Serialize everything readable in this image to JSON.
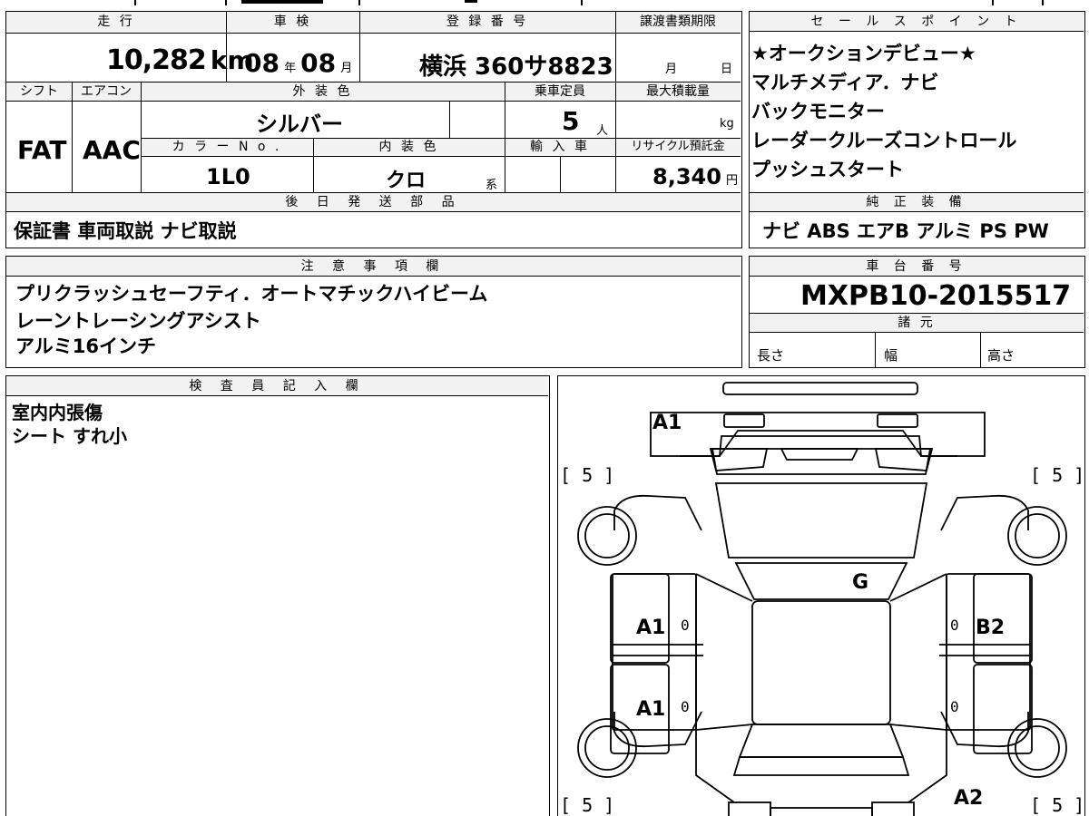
{
  "top_table": {
    "labels": {
      "mileage": "走 行",
      "inspection": "車 検",
      "registration": "登 録 番 号",
      "transfer_deadline": "譲渡書類期限",
      "shift": "シフト",
      "aircon": "エアコン",
      "exterior_color": "外 装 色",
      "capacity": "乗車定員",
      "max_load": "最大積載量",
      "color_no": "カ ラ ー N o .",
      "interior_color": "内 装 色",
      "import": "輸 入 車",
      "recycle": "リサイクル預託金",
      "later_parts": "後 日 発 送 部 品"
    },
    "mileage_value": "10,282",
    "mileage_unit": "km",
    "inspection_year": "08",
    "inspection_year_unit": "年",
    "inspection_month": "08",
    "inspection_month_unit": "月",
    "registration_value": "横浜 360サ8823",
    "transfer_month_unit": "月",
    "transfer_day_unit": "日",
    "shift_value": "FAT",
    "aircon_value": "AAC",
    "exterior_color_value": "シルバー",
    "capacity_value": "5",
    "capacity_unit": "人",
    "max_load_unit": "kg",
    "color_no_value": "1L0",
    "interior_color_value": "クロ",
    "interior_suffix": "系",
    "recycle_value": "8,340",
    "recycle_unit": "円",
    "later_parts_value": "保証書 車両取説 ナビ取説"
  },
  "sales_points": {
    "title": "セ ー ル ス ポ イ ン ト",
    "items": [
      "★オークションデビュー★",
      "マルチメディア．ナビ",
      "バックモニター",
      "レーダークルーズコントロール",
      "プッシュスタート"
    ]
  },
  "equipment": {
    "title": "純 正 装 備",
    "value": "ナビ ABS エアB アルミ PS PW"
  },
  "notes": {
    "title": "注 意 事 項 欄",
    "lines": [
      "プリクラッシュセーフティ．オートマチックハイビーム",
      "レーントレーシングアシスト",
      "アルミ16インチ"
    ]
  },
  "chassis": {
    "title": "車 台 番 号",
    "value": "MXPB10-2015517",
    "spec_title": "諸 元",
    "length": "長さ",
    "width": "幅",
    "height": "高さ"
  },
  "inspector": {
    "title": "検 査 員 記 入 欄",
    "lines": [
      "室内内張傷",
      "シート すれ小"
    ]
  },
  "diagram": {
    "marks": [
      "A1",
      "G",
      "A1",
      "B2",
      "A1",
      "A2"
    ],
    "zeros": [
      "0",
      "0",
      "0",
      "0"
    ],
    "tire": "[ 5 ]"
  }
}
